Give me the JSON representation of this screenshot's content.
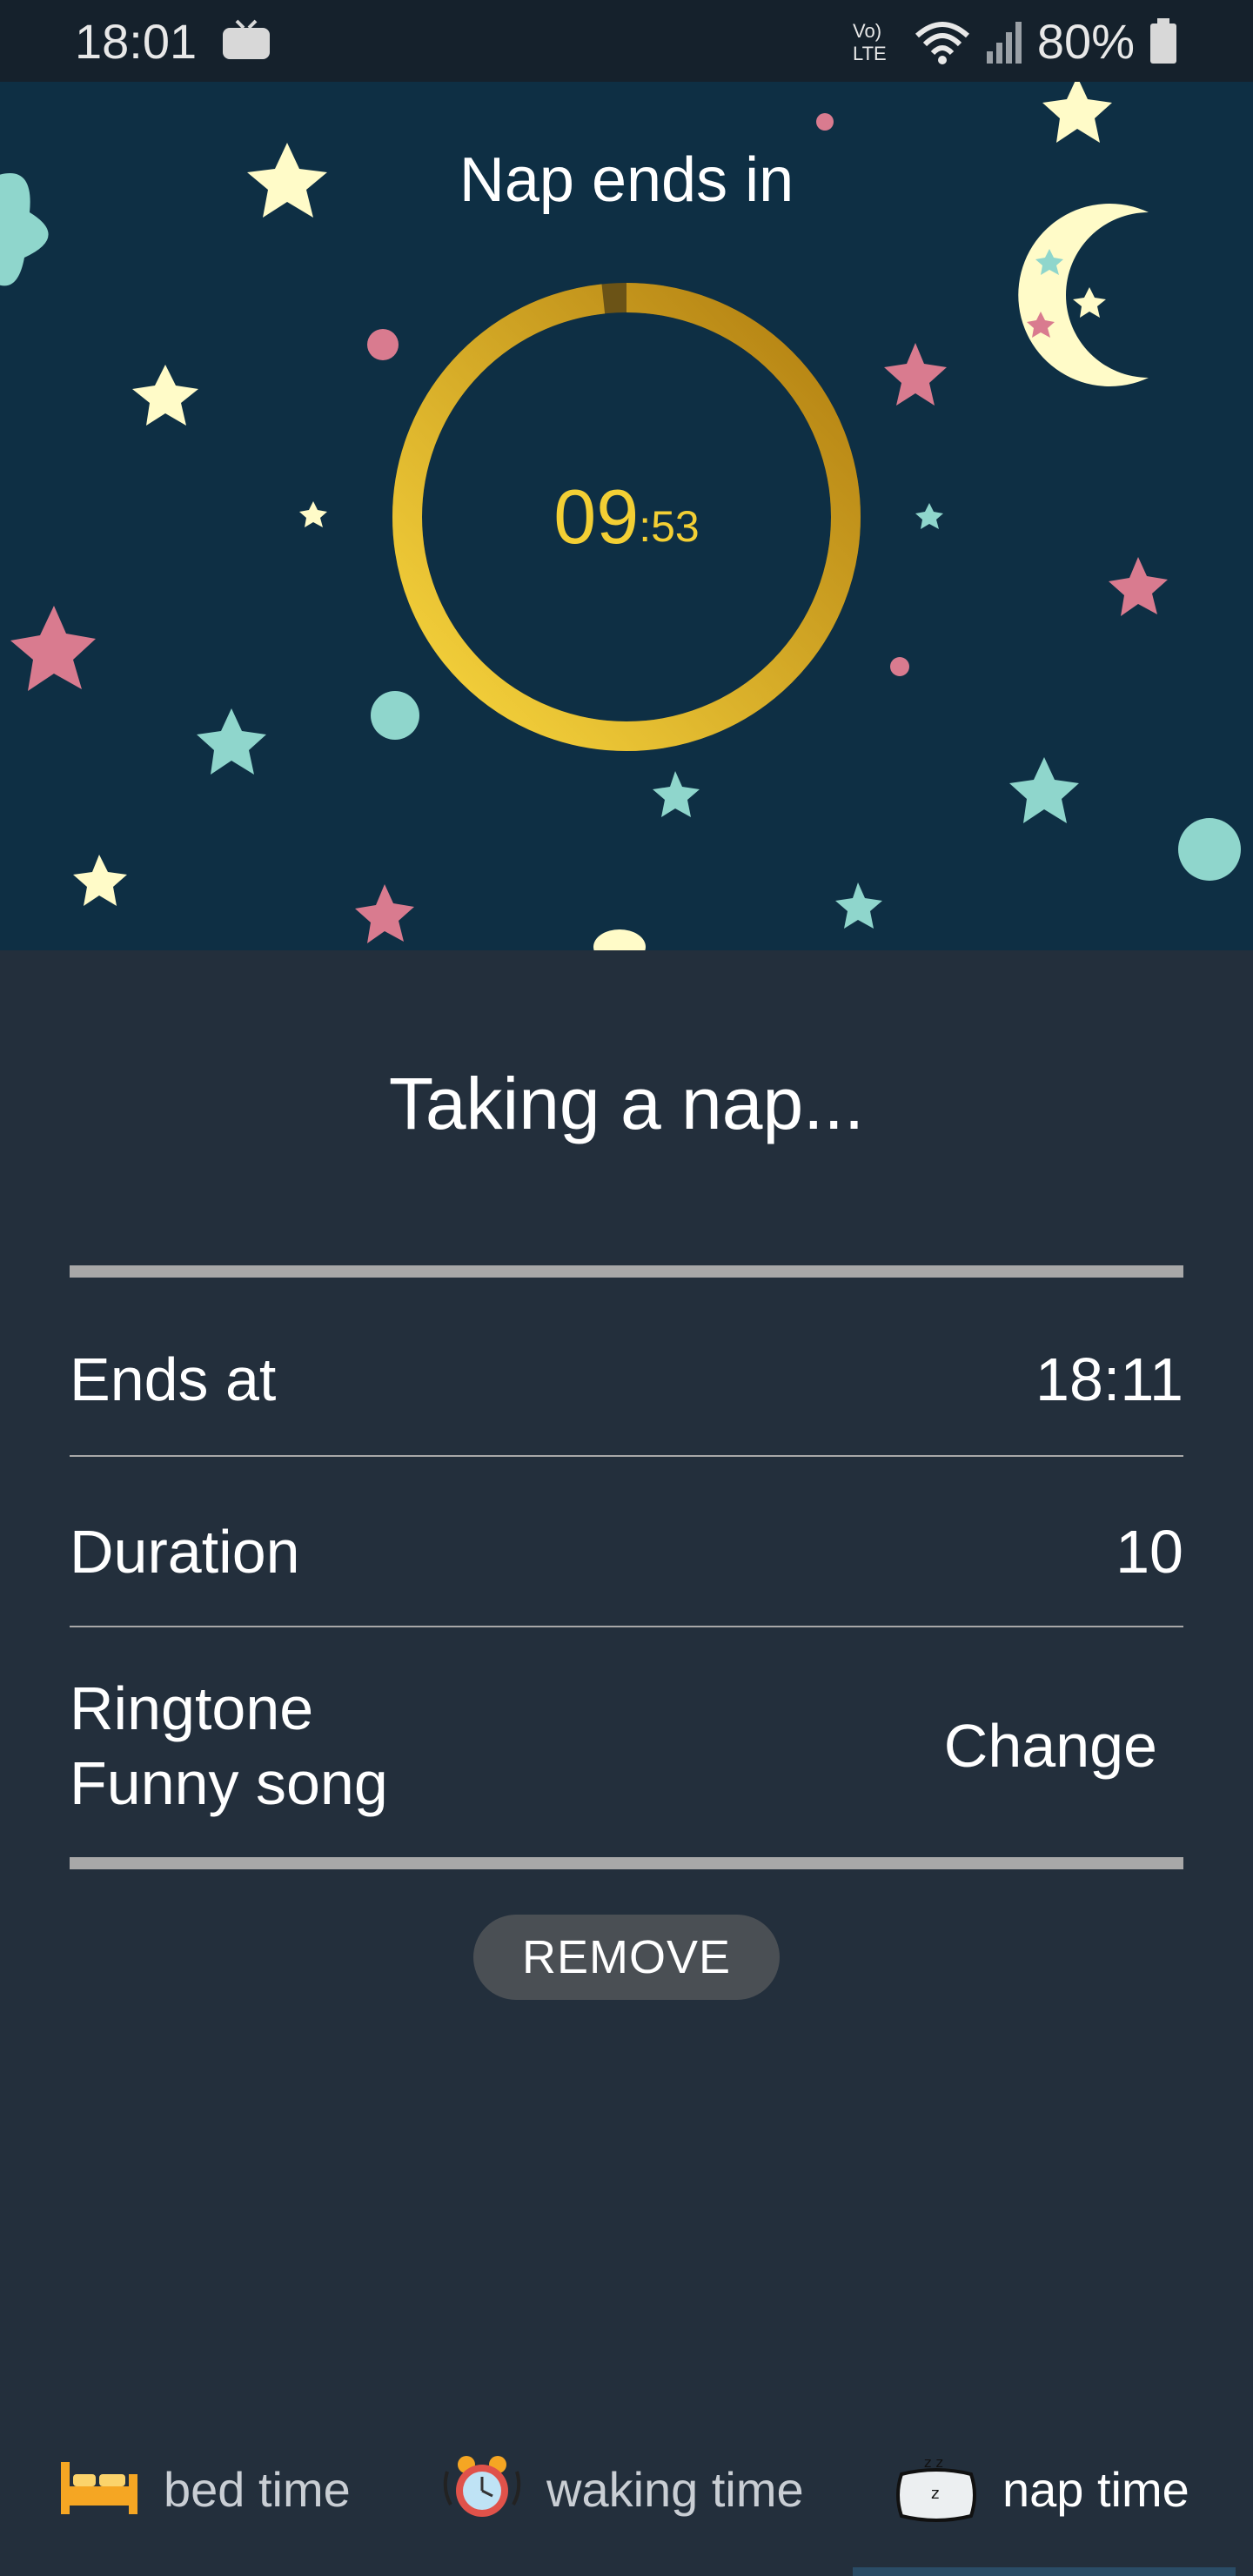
{
  "status_bar": {
    "time": "18:01",
    "battery_percent": "80%",
    "icons": [
      "tv-icon",
      "volte-icon",
      "wifi-icon",
      "signal-icon",
      "battery-icon"
    ]
  },
  "hero": {
    "title": "Nap ends in",
    "countdown_minutes": "09",
    "countdown_seconds": ":53",
    "progress_fraction_remaining": 0.983,
    "colors": {
      "background": "#0e2f44",
      "ring_progress": "#f3cf34",
      "ring_track": "#6b5316",
      "countdown_text": "#f3cf34"
    }
  },
  "main": {
    "heading": "Taking a nap...",
    "rows": [
      {
        "label": "Ends at",
        "value": "18:11"
      },
      {
        "label": "Duration",
        "value": "10"
      }
    ],
    "ringtone": {
      "label": "Ringtone",
      "song": "Funny song",
      "change_label": "Change"
    },
    "remove_label": "REMOVE"
  },
  "bottom_nav": {
    "items": [
      {
        "label": "bed time",
        "icon": "bed-icon",
        "active": false
      },
      {
        "label": "waking time",
        "icon": "alarm-clock-icon",
        "active": false
      },
      {
        "label": "nap time",
        "icon": "pillow-icon",
        "active": true
      }
    ]
  }
}
